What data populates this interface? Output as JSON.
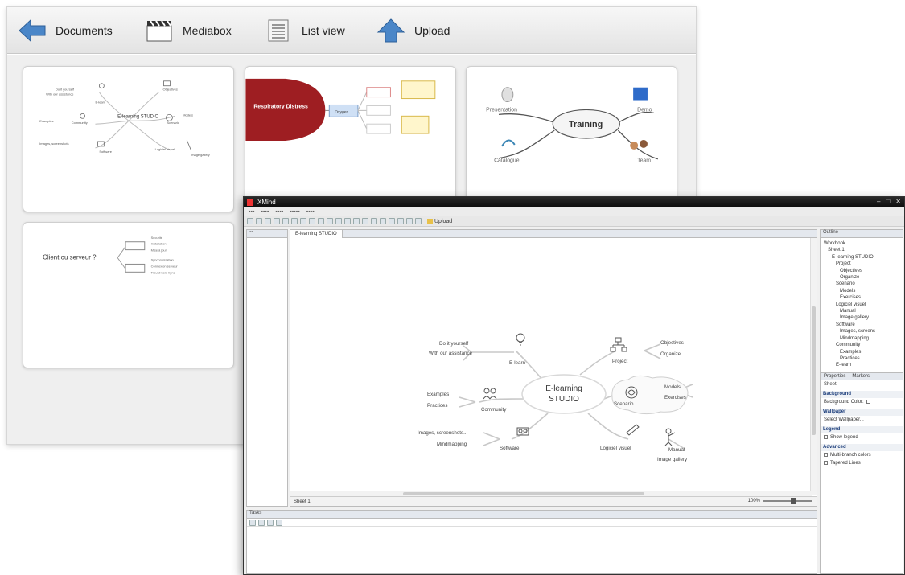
{
  "toolbar": {
    "documents": "Documents",
    "mediabox": "Mediabox",
    "list_view": "List view",
    "upload": "Upload"
  },
  "cards": {
    "training": {
      "center": "Training",
      "presentation": "Presentation",
      "demo": "Demo",
      "catalogue": "Catalogue",
      "team": "Team"
    },
    "respiratory": {
      "center": "Respiratory Distress",
      "node": "Oxygen"
    },
    "client": {
      "center": "Client ou serveur ?"
    },
    "elearning_mini": {
      "center": "E-learning STUDIO"
    }
  },
  "editor": {
    "title": "XMind",
    "upload_label": "Upload",
    "canvas_tab": "E-learning STUDIO",
    "sheet_label": "Sheet 1",
    "zoom": "100%",
    "map": {
      "center_line1": "E-learning",
      "center_line2": "STUDIO",
      "do_it": "Do it yourself",
      "with_assist": "With our assistance",
      "elearn": "E-learn",
      "project": "Project",
      "objectives": "Objectives",
      "organize": "Organize",
      "examples": "Examples",
      "practices": "Practices",
      "community": "Community",
      "scenario": "Scenario",
      "models": "Models",
      "exercises": "Exercises",
      "images": "Images, screenshots...",
      "mindmapping": "Mindmapping",
      "software": "Software",
      "logiciel": "Logiciel visuel",
      "manual": "Manual",
      "gallery": "Image gallery"
    },
    "outline": {
      "title": "Outline",
      "items": [
        "Workbook",
        "Sheet 1",
        "E-learning STUDIO",
        "Project",
        "Objectives",
        "Organize",
        "Scenario",
        "Models",
        "Exercises",
        "Logiciel visuel",
        "Manual",
        "Image gallery",
        "Software",
        "Images, screens",
        "Mindmapping",
        "Community",
        "Examples",
        "Practices",
        "E-learn"
      ]
    },
    "properties": {
      "tab1": "Properties",
      "tab2": "Markers",
      "sheet": "Sheet",
      "background": "Background",
      "bg_color": "Background Color:",
      "wallpaper": "Wallpaper",
      "wallpaper_value": "Select Wallpaper...",
      "legend": "Legend",
      "show_legend": "Show legend",
      "advanced": "Advanced",
      "multi_branch": "Multi-branch colors",
      "tapered": "Tapered Lines"
    },
    "tasks_tab": "Tasks"
  }
}
